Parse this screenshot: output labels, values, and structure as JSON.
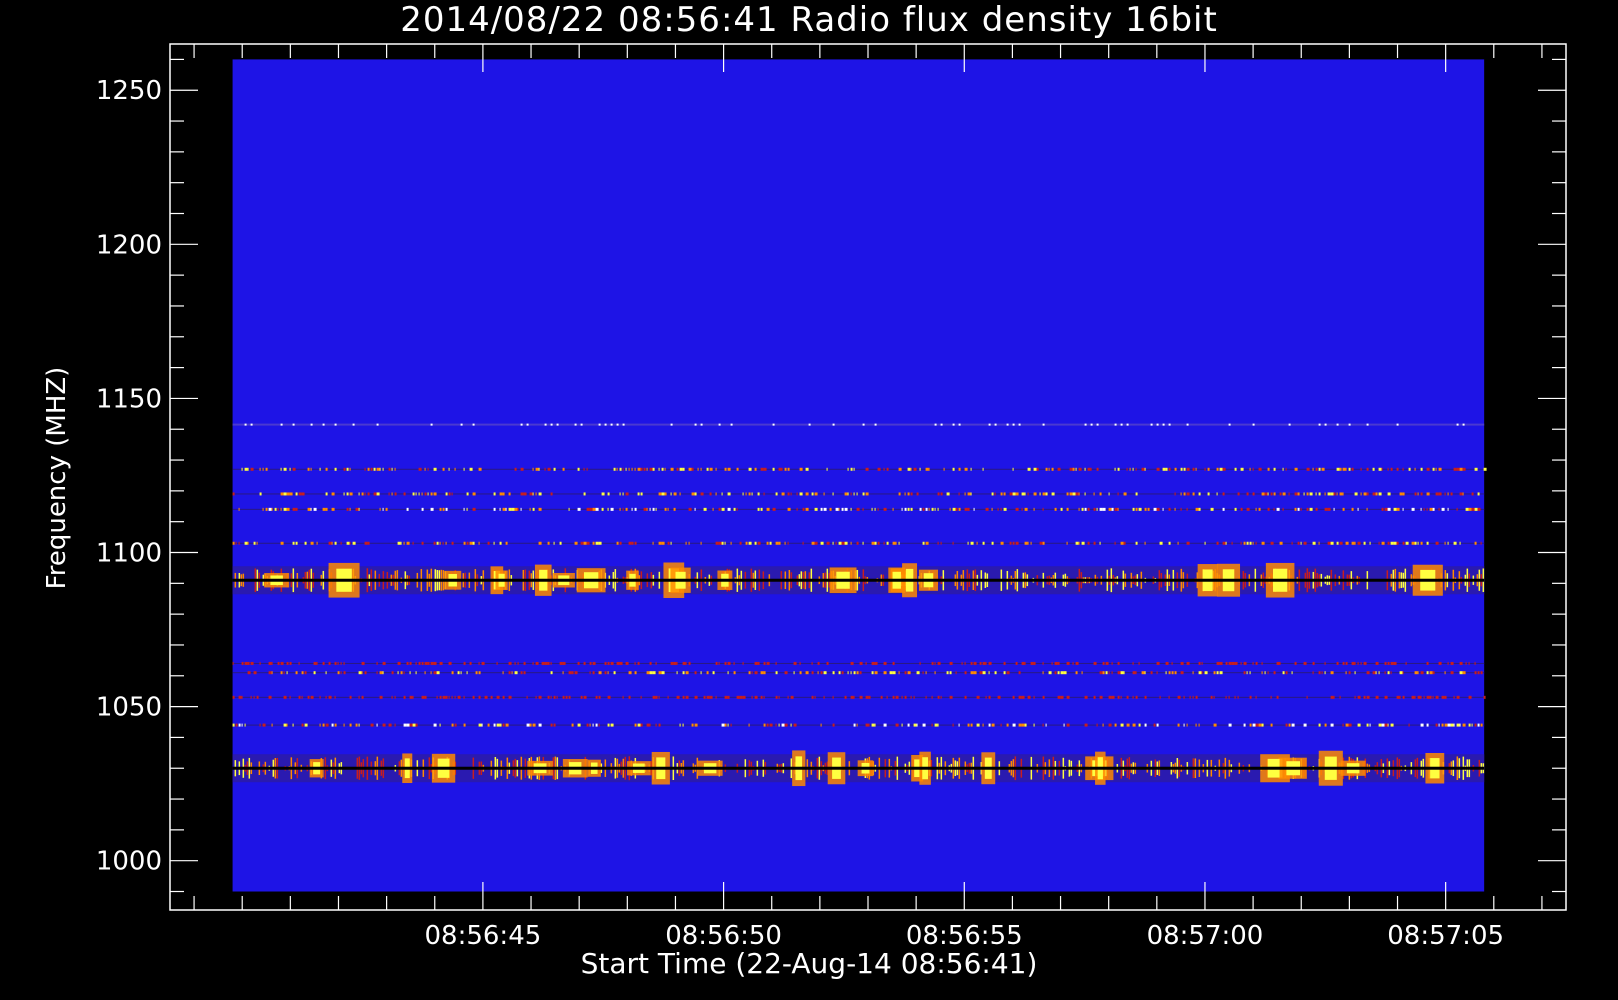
{
  "chart_data": {
    "type": "heatmap",
    "title": "2014/08/22 08:56:41 Radio flux density 16bit",
    "xlabel": "Start Time (22-Aug-14 08:56:41)",
    "ylabel": "Frequency (MHZ)",
    "x_tick_labels": [
      "08:56:45",
      "08:56:50",
      "08:56:55",
      "08:57:00",
      "08:57:05"
    ],
    "x_tick_seconds": [
      4,
      9,
      14,
      19,
      24
    ],
    "xlim_seconds": [
      -2.5,
      26.5
    ],
    "data_x_range_seconds": [
      -1.2,
      24.8
    ],
    "y_tick_labels": [
      "1000",
      "1050",
      "1100",
      "1150",
      "1200",
      "1250"
    ],
    "y_tick_values": [
      1000,
      1050,
      1100,
      1150,
      1200,
      1250
    ],
    "ylim": [
      984,
      1265
    ],
    "data_y_range": [
      990,
      1260
    ],
    "colors": {
      "background": "#1e14e6",
      "weak": "#c81e1e",
      "medium": "#ff8a00",
      "strong": "#ffff40",
      "peak": "#ffffff",
      "dropout": "#000000"
    },
    "emission_bands_mhz": [
      {
        "center": 1141.5,
        "intensity": "weak",
        "type": "line"
      },
      {
        "center": 1127,
        "intensity": "medium",
        "type": "dotted"
      },
      {
        "center": 1119,
        "intensity": "medium",
        "type": "dotted"
      },
      {
        "center": 1114,
        "intensity": "strong",
        "type": "dotted"
      },
      {
        "center": 1103,
        "intensity": "medium",
        "type": "dotted"
      },
      {
        "center": 1091,
        "intensity": "strong",
        "type": "bursty"
      },
      {
        "center": 1064,
        "intensity": "weak",
        "type": "dotted"
      },
      {
        "center": 1061,
        "intensity": "medium",
        "type": "dotted"
      },
      {
        "center": 1053,
        "intensity": "weak",
        "type": "dotted"
      },
      {
        "center": 1044,
        "intensity": "strong",
        "type": "dotted"
      },
      {
        "center": 1030,
        "intensity": "strong",
        "type": "bursty"
      }
    ],
    "grid": false,
    "legend": "none"
  }
}
